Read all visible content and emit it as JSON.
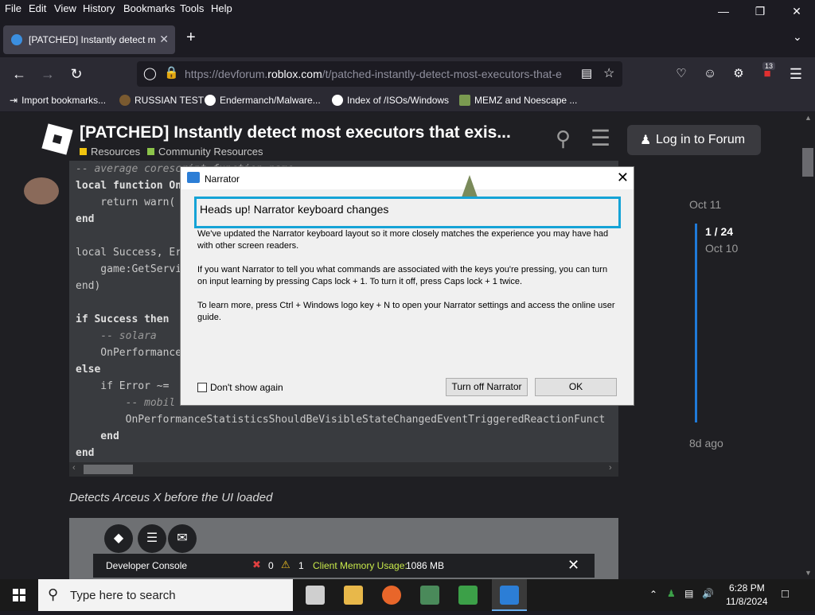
{
  "menu": [
    "File",
    "Edit",
    "View",
    "History",
    "Bookmarks",
    "Tools",
    "Help"
  ],
  "menu_underlines": [
    "F",
    "E",
    "V",
    "s",
    "B",
    "T",
    "H"
  ],
  "tab": {
    "title": "[PATCHED] Instantly detect mo"
  },
  "nav": {
    "url_prefix": "https://devforum.",
    "url_domain": "roblox.com",
    "url_path": "/t/patched-instantly-detect-most-executors-that-e",
    "ext_badge": "13"
  },
  "bookmarks": [
    "Import bookmarks...",
    "RUSSIAN TEST",
    "Endermanch/Malware...",
    "Index of /ISOs/Windows",
    "MEMZ and Noescape ..."
  ],
  "forum": {
    "title": "[PATCHED] Instantly detect most executors that exis...",
    "categories": [
      {
        "label": "Resources",
        "color": "#f1c40f"
      },
      {
        "label": "Community Resources",
        "color": "#8bc34a"
      }
    ],
    "login": "Log in to Forum",
    "caption": "Detects Arceus X before the UI loaded"
  },
  "code_lines": [
    {
      "t": "-- average corescript function name:",
      "c": "cm"
    },
    {
      "t": "local function On",
      "c": "kw"
    },
    {
      "t": "    return warn(",
      "c": ""
    },
    {
      "t": "end",
      "c": "kw"
    },
    {
      "t": "",
      "c": ""
    },
    {
      "t": "local Success, Er",
      "c": ""
    },
    {
      "t": "    game:GetServi",
      "c": ""
    },
    {
      "t": "end)",
      "c": ""
    },
    {
      "t": "",
      "c": ""
    },
    {
      "t": "if Success then",
      "c": "kw"
    },
    {
      "t": "    -- solara",
      "c": "cm"
    },
    {
      "t": "    OnPerformance",
      "c": ""
    },
    {
      "t": "else",
      "c": "kw"
    },
    {
      "t": "    if Error ~=",
      "c": ""
    },
    {
      "t": "        -- mobil",
      "c": "cm"
    },
    {
      "t": "        OnPerformanceStatisticsShouldBeVisibleStateChangedEventTriggeredReactionFunct",
      "c": ""
    },
    {
      "t": "    end",
      "c": "kw"
    },
    {
      "t": "end",
      "c": "kw"
    }
  ],
  "timeline": {
    "start": "Oct 11",
    "position": "1 / 24",
    "position_date": "Oct 10",
    "end": "8d ago"
  },
  "devconsole": {
    "title": "Developer Console",
    "errors": "0",
    "warnings": "1",
    "memory_label": "Client Memory Usage:",
    "memory_value": "1086 MB"
  },
  "narrator": {
    "window_title": "Narrator",
    "heading": "Heads up! Narrator keyboard changes",
    "paragraphs": [
      "We've updated the Narrator keyboard layout so it more closely matches the experience you may have had with other screen readers.",
      "If you want Narrator to tell you what commands are associated with the keys you're pressing, you can turn on input learning by pressing Caps lock + 1. To turn it off, press Caps lock + 1 twice.",
      "To learn more, press Ctrl + Windows logo key + N to open your Narrator settings and access the online user guide."
    ],
    "checkbox_label": "Don't show again",
    "turn_off_label": "Turn off Narrator",
    "ok_label": "OK"
  },
  "taskbar": {
    "search_placeholder": "Type here to search",
    "time": "6:28 PM",
    "date": "11/8/2024"
  }
}
